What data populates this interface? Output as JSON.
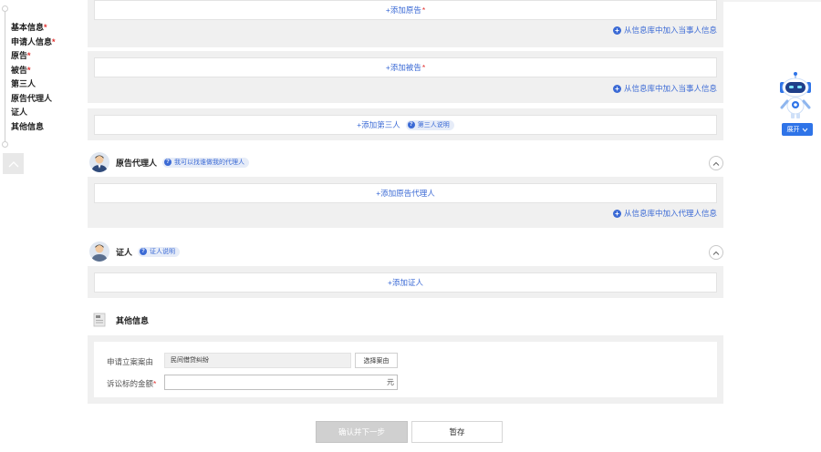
{
  "nav": {
    "items": [
      {
        "label": "基本信息",
        "required": "*"
      },
      {
        "label": "申请人信息",
        "required": "*"
      },
      {
        "label": "原告",
        "required": "*"
      },
      {
        "label": "被告",
        "required": "*"
      },
      {
        "label": "第三人",
        "required": ""
      },
      {
        "label": "原告代理人",
        "required": ""
      },
      {
        "label": "证人",
        "required": ""
      },
      {
        "label": "其他信息",
        "required": ""
      }
    ]
  },
  "plaintiff": {
    "add_label": "+添加原告",
    "required": "*",
    "lib_link": "从信息库中加入当事人信息"
  },
  "defendant": {
    "add_label": "+添加被告",
    "required": "*",
    "lib_link": "从信息库中加入当事人信息"
  },
  "third_party": {
    "add_label": "+添加第三人",
    "help": "第三人说明"
  },
  "agent": {
    "title": "原告代理人",
    "help": "我可以找谁做我的代理人",
    "add_label": "+添加原告代理人",
    "lib_link": "从信息库中加入代理人信息"
  },
  "witness": {
    "title": "证人",
    "help": "证人说明",
    "add_label": "+添加证人"
  },
  "other": {
    "title": "其他信息",
    "cause_label": "申请立案案由",
    "cause_value": "民间借贷纠纷",
    "select_cause_button": "选择案由",
    "amount_label": "诉讼标的金额",
    "amount_required": "*",
    "amount_value": "",
    "amount_unit": "元"
  },
  "actions": {
    "confirm": "确认并下一步",
    "save": "暂存"
  },
  "assistant": {
    "expand_label": "展开"
  },
  "colors": {
    "accent": "#3b6ad5",
    "required": "#e0312f",
    "panel": "#f0f0f0",
    "button_primary_disabled": "#d0d0d0",
    "robot_blue": "#2f74e8"
  }
}
